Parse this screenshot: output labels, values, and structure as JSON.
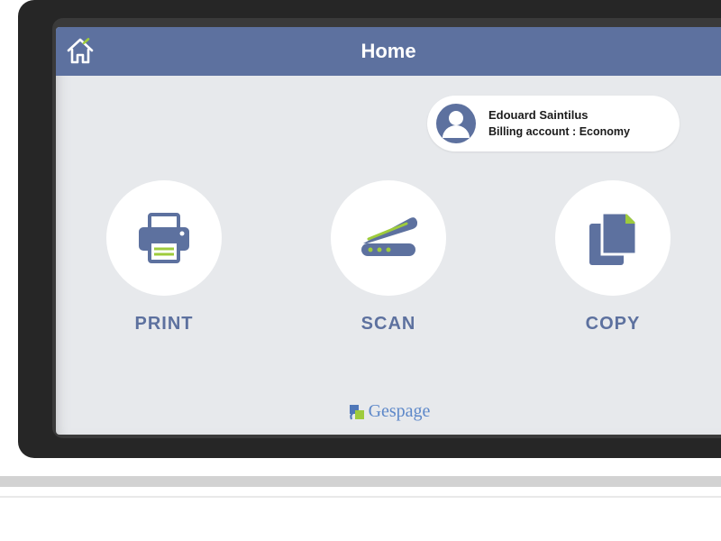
{
  "header": {
    "title": "Home"
  },
  "user": {
    "name": "Edouard Saintilus",
    "billing_label": "Billing account : Economy"
  },
  "actions": {
    "print": {
      "label": "PRINT"
    },
    "scan": {
      "label": "SCAN"
    },
    "copy": {
      "label": "COPY"
    }
  },
  "brand": {
    "name": "Gespage"
  },
  "colors": {
    "accent_blue": "#5d719f",
    "accent_green": "#9ecb3c"
  }
}
